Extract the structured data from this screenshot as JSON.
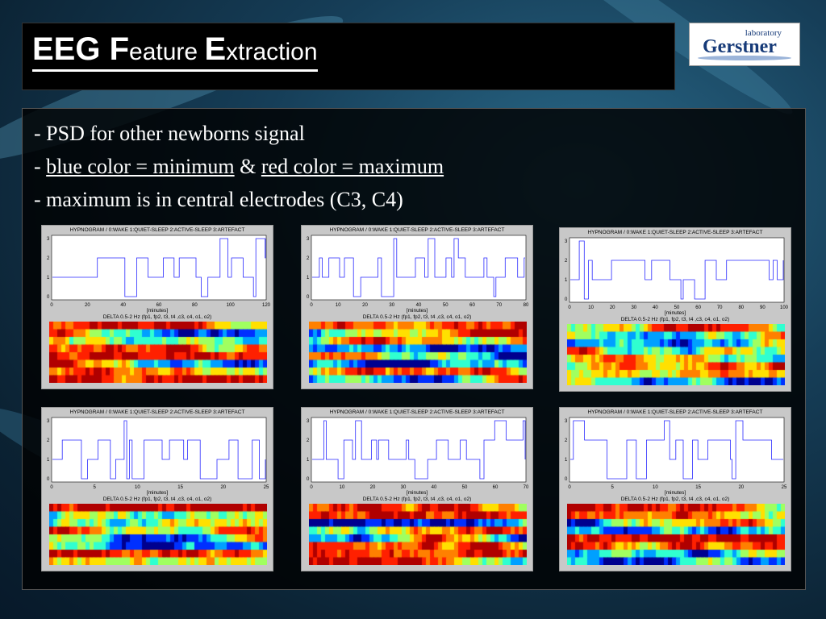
{
  "title": {
    "part1_big": "EEG F",
    "part1_small": "eature ",
    "part2_big": "E",
    "part2_small": "xtraction"
  },
  "logo": {
    "top": "laboratory",
    "main": "Gerstner"
  },
  "bullets": {
    "line1": "- PSD for other newborns signal",
    "line2_prefix": "- ",
    "line2_blue": "blue color = minimum",
    "line2_amp": " & ",
    "line2_red": "red color = maximum",
    "line3": "- maximum is in central electrodes (C3, C4)"
  },
  "panel_common": {
    "hyp_title": "HYPNOGRAM / 0:WAKE  1:QUIET-SLEEP  2:ACTIVE-SLEEP  3:ARTEFACT",
    "x_label": "[minutes]",
    "delta_title": "DELTA 0.5-2 Hz (fp1, fp2, t3, t4 ,c3, c4, o1, o2)",
    "y_ticks": [
      "0",
      "1",
      "2",
      "3"
    ]
  },
  "panels": [
    {
      "x_ticks": [
        "0",
        "20",
        "40",
        "60",
        "80",
        "100",
        "120"
      ]
    },
    {
      "x_ticks": [
        "0",
        "10",
        "20",
        "30",
        "40",
        "50",
        "60",
        "70",
        "80"
      ]
    },
    {
      "x_ticks": [
        "0",
        "10",
        "20",
        "30",
        "40",
        "50",
        "60",
        "70",
        "80",
        "90",
        "100"
      ]
    },
    {
      "x_ticks": [
        "0",
        "5",
        "10",
        "15",
        "20",
        "25"
      ]
    },
    {
      "x_ticks": [
        "0",
        "10",
        "20",
        "30",
        "40",
        "50",
        "60",
        "70"
      ]
    },
    {
      "x_ticks": [
        "0",
        "5",
        "10",
        "15",
        "20",
        "25"
      ]
    }
  ],
  "colors": {
    "hypnogram_line": "#2a2aff",
    "min": "#0000c0",
    "max": "#e00000"
  }
}
